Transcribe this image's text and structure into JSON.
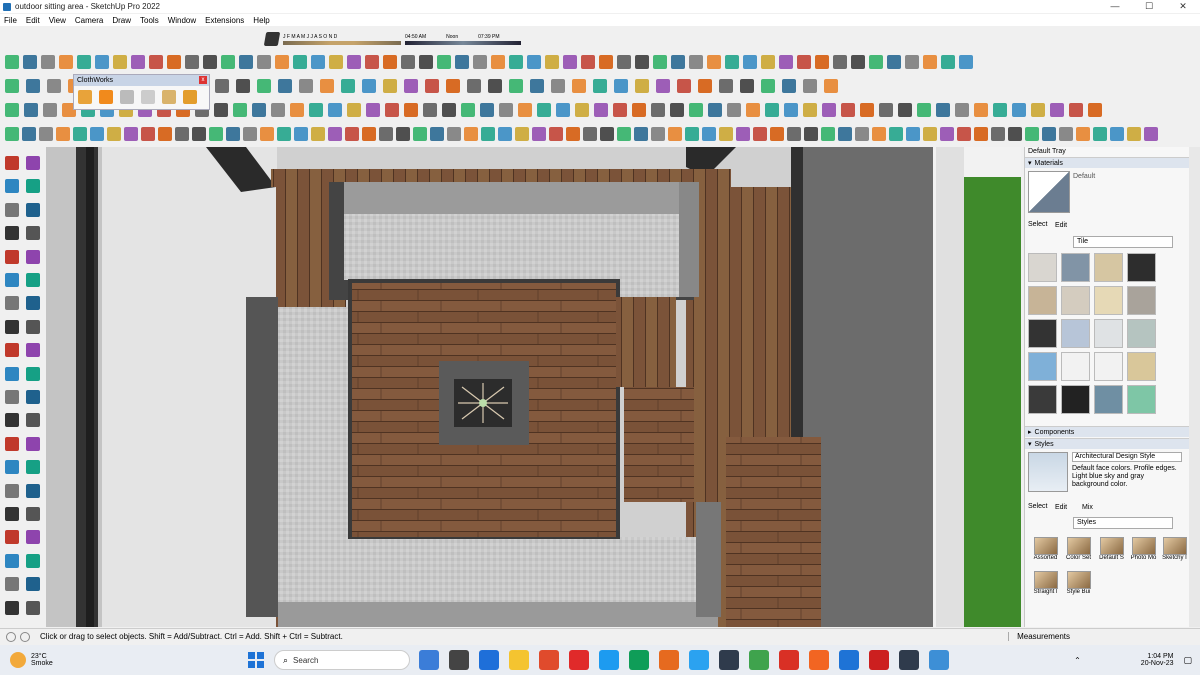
{
  "window": {
    "title": "outdoor sitting area - SketchUp Pro 2022",
    "minimize": "—",
    "maximize": "☐",
    "close": "✕"
  },
  "menu": [
    "File",
    "Edit",
    "View",
    "Camera",
    "Draw",
    "Tools",
    "Window",
    "Extensions",
    "Help"
  ],
  "shadows": {
    "months": "J F M A M J J A S O N D",
    "time_start": "04:50 AM",
    "time_mid": "Noon",
    "time_end": "07:39 PM"
  },
  "clothworks": {
    "title": "ClothWorks",
    "close": "x"
  },
  "tray": {
    "title": "Default Tray",
    "materials": {
      "header": "Materials",
      "current": "Default",
      "tab_select": "Select",
      "tab_edit": "Edit",
      "library": "Tile"
    },
    "components": {
      "header": "Components"
    },
    "styles": {
      "header": "Styles",
      "name": "Architectural Design Style",
      "description": "Default face colors. Profile edges. Light blue sky and gray background color.",
      "tab_select": "Select",
      "tab_edit": "Edit",
      "tab_mix": "Mix",
      "library": "Styles",
      "items": [
        "Assorted",
        "Color Set",
        "Default S",
        "Photo Mo",
        "Sketchy I",
        "Straight l",
        "Style Bui"
      ]
    }
  },
  "status": {
    "message": "Click or drag to select objects. Shift = Add/Subtract. Ctrl = Add. Shift + Ctrl = Subtract.",
    "measurements": "Measurements"
  },
  "taskbar": {
    "temperature": "23°C",
    "weather": "Smoke",
    "search": "Search",
    "time": "1:04 PM",
    "date": "20-Nov-23"
  },
  "colors": {
    "tile_swatches": [
      "#d9d6d0",
      "#8194a6",
      "#d6c6a2",
      "#2d2d2d",
      "#c7b497",
      "#d4ccbf",
      "#e6d9b6",
      "#a9a39b",
      "#333333",
      "#b7c5d8",
      "#dfe2e4",
      "#b5c4c0",
      "#7fb0d8",
      "#f2f2f2",
      "#f2f2f2",
      "#d9c79a",
      "#3a3a3a",
      "#222222",
      "#6f8fa3",
      "#7ec6a6"
    ]
  }
}
